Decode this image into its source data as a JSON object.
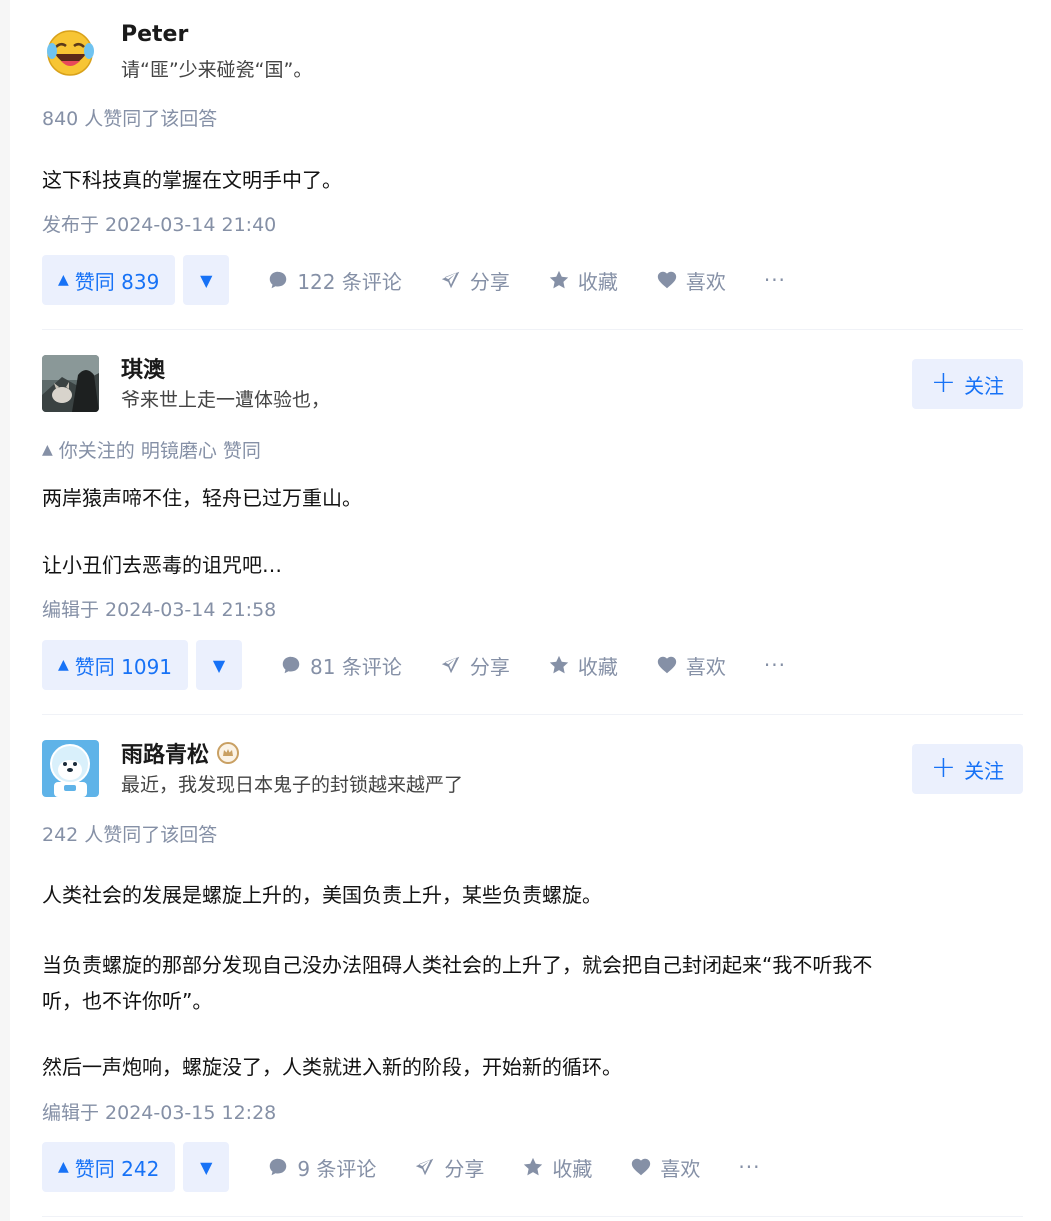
{
  "answers": [
    {
      "author_name": "Peter",
      "author_bio": "请“匪”少来碰瓷“国”。",
      "vote_summary": "840 人赞同了该回答",
      "paragraphs": [
        "这下科技真的掌握在文明手中了。"
      ],
      "timestamp": "发布于 2024-03-14 21:40",
      "upvote_label": "赞同 839",
      "comments_label": "122 条评论",
      "share_label": "分享",
      "collect_label": "收藏",
      "like_label": "喜欢",
      "more_label": "···"
    },
    {
      "author_name": "琪澳",
      "author_bio": "爷来世上走一遭体验也，",
      "follow_label": "关注",
      "vote_summary": "你关注的 明镜磨心 赞同",
      "paragraphs": [
        "两岸猿声啼不住，轻舟已过万重山。",
        "让小丑们去恶毒的诅咒吧…"
      ],
      "timestamp": "编辑于 2024-03-14 21:58",
      "upvote_label": "赞同 1091",
      "comments_label": "81 条评论",
      "share_label": "分享",
      "collect_label": "收藏",
      "like_label": "喜欢",
      "more_label": "···"
    },
    {
      "author_name": "雨路青松",
      "author_bio": "最近，我发现日本鬼子的封锁越来越严了",
      "follow_label": "关注",
      "vote_summary": "242 人赞同了该回答",
      "paragraphs": [
        "人类社会的发展是螺旋上升的，美国负责上升，某些负责螺旋。",
        "当负责螺旋的那部分发现自己没办法阻碍人类社会的上升了，就会把自己封闭起来“我不听我不",
        "听，也不许你听”。",
        "然后一声炮响，螺旋没了，人类就进入新的阶段，开始新的循环。"
      ],
      "timestamp": "编辑于 2024-03-15 12:28",
      "upvote_label": "赞同 242",
      "comments_label": "9 条评论",
      "share_label": "分享",
      "collect_label": "收藏",
      "like_label": "喜欢",
      "more_label": "···"
    }
  ],
  "colors": {
    "accent": "#1772f6",
    "accent_bg": "#ebf0fd",
    "meta": "#8590a6",
    "badge": "#c9a063"
  }
}
